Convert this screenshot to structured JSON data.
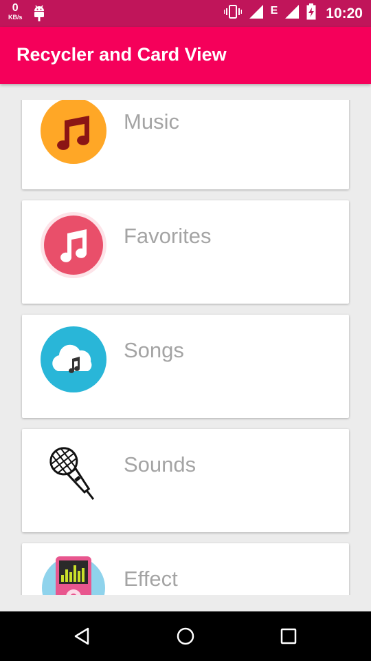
{
  "status_bar": {
    "data_rate_value": "0",
    "data_rate_unit": "KB/s",
    "network_label": "E",
    "time": "10:20",
    "icons": [
      "android-debug-icon",
      "vibrate-icon",
      "signal-icon",
      "signal-icon",
      "battery-charging-icon"
    ]
  },
  "app_bar": {
    "title": "Recycler and Card View",
    "color": "#f5005a"
  },
  "cards": [
    {
      "label": "Music",
      "icon": "music-note-icon",
      "color": "#ffa726"
    },
    {
      "label": "Favorites",
      "icon": "itunes-note-icon",
      "color": "#e94f6a"
    },
    {
      "label": "Songs",
      "icon": "cloud-music-icon",
      "color": "#29b6d8"
    },
    {
      "label": "Sounds",
      "icon": "microphone-icon",
      "color": "#000000"
    },
    {
      "label": "Effect",
      "icon": "music-player-icon",
      "color": "#e8568e"
    }
  ],
  "nav_bar": {
    "buttons": [
      "back",
      "home",
      "recents"
    ]
  }
}
